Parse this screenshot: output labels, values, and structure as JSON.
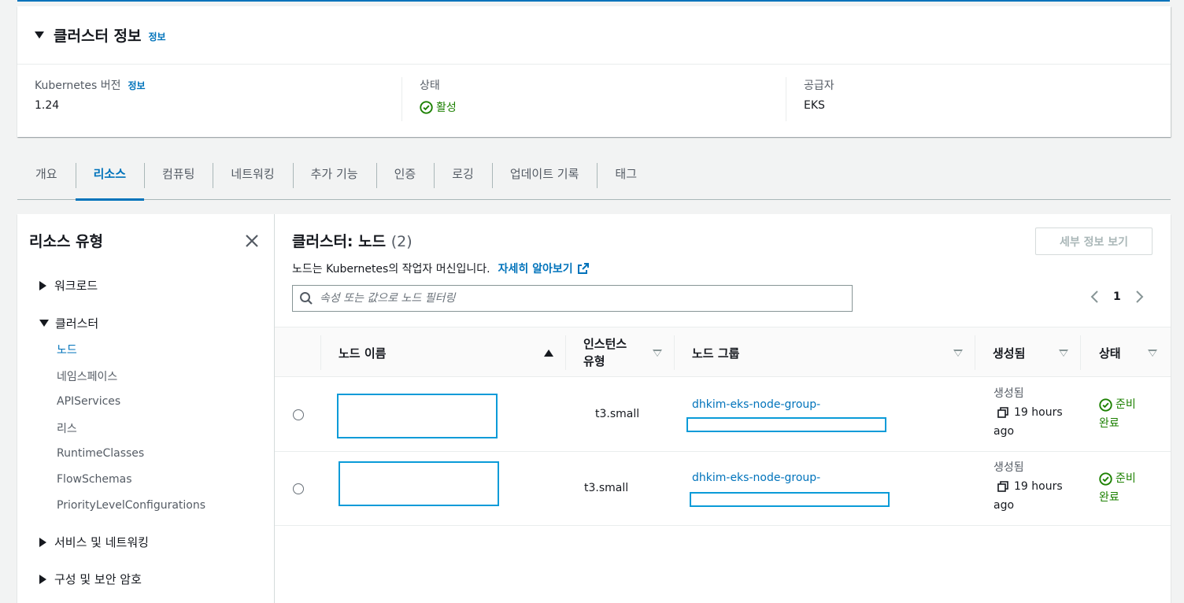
{
  "cluster_info": {
    "title": "클러스터 정보",
    "info_link": "정보",
    "kubernetes_version_label": "Kubernetes 버전",
    "kubernetes_version_info": "정보",
    "kubernetes_version": "1.24",
    "status_label": "상태",
    "status_value": "활성",
    "provider_label": "공급자",
    "provider_value": "EKS"
  },
  "tabs": [
    {
      "label": "개요"
    },
    {
      "label": "리소스",
      "active": true
    },
    {
      "label": "컴퓨팅"
    },
    {
      "label": "네트워킹"
    },
    {
      "label": "추가 기능"
    },
    {
      "label": "인증"
    },
    {
      "label": "로깅"
    },
    {
      "label": "업데이트 기록"
    },
    {
      "label": "태그"
    }
  ],
  "sidebar": {
    "title": "리소스 유형",
    "groups": [
      {
        "label": "워크로드",
        "expanded": false
      },
      {
        "label": "클러스터",
        "expanded": true
      },
      {
        "label": "서비스 및 네트워킹",
        "expanded": false
      },
      {
        "label": "구성 및 보안 암호",
        "expanded": false
      }
    ],
    "cluster_items": [
      {
        "label": "노드",
        "active": true
      },
      {
        "label": "네임스페이스"
      },
      {
        "label": "APIServices"
      },
      {
        "label": "리스"
      },
      {
        "label": "RuntimeClasses"
      },
      {
        "label": "FlowSchemas"
      },
      {
        "label": "PriorityLevelConfigurations"
      }
    ]
  },
  "main": {
    "title": "클러스터: 노드",
    "count": "(2)",
    "details_button": "세부 정보 보기",
    "description": "노드는 Kubernetes의 작업자 머신입니다.",
    "learn_more": "자세히 알아보기",
    "search_placeholder": "속성 또는 값으로 노드 필터링",
    "page": "1"
  },
  "table": {
    "columns": [
      "노드 이름",
      "인스턴스 유형",
      "노드 그룹",
      "생성됨",
      "상태"
    ],
    "rows": [
      {
        "instance_type": "t3.small",
        "node_group": "dhkim-eks-node-group-",
        "created_label": "생성됨",
        "created_rel": "19 hours",
        "created_ago": "ago",
        "status_1": "준비",
        "status_2": "완료"
      },
      {
        "instance_type": "t3.small",
        "node_group": "dhkim-eks-node-group-",
        "created_label": "생성됨",
        "created_rel": "19 hours",
        "created_ago": "ago",
        "status_1": "준비",
        "status_2": "완료"
      }
    ]
  },
  "colors": {
    "accent": "#0073bb",
    "success": "#1d8102",
    "redaction": "#0a9bd8"
  }
}
